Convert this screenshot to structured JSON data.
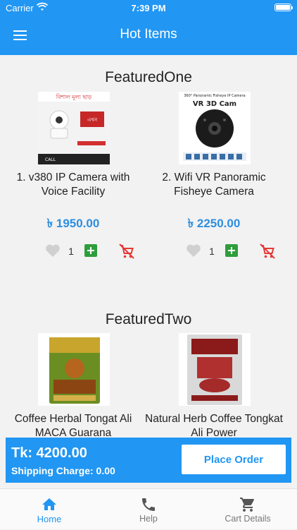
{
  "status_bar": {
    "carrier": "Carrier",
    "time": "7:39 PM"
  },
  "app_bar": {
    "title": "Hot Items",
    "menu_icon": "hamburger-menu-icon"
  },
  "sections": [
    {
      "title": "FeaturedOne",
      "products": [
        {
          "name": "1. v380 IP Camera with Voice Facility",
          "price": "৳ 1950.00",
          "quantity": "1",
          "image_text": [
            "বিশাল মূল্য ছাড়",
            "এখন",
            "CALL"
          ]
        },
        {
          "name": "2. Wifi VR Panoramic Fisheye Camera",
          "price": "৳ 2250.00",
          "quantity": "1",
          "image_text": [
            "360° Panoramic Fisheye IP Camera",
            "VR 3D Cam"
          ]
        }
      ]
    },
    {
      "title": "FeaturedTwo",
      "products": [
        {
          "name": "Coffee Herbal Tongat Ali MACA Guarana",
          "price": "",
          "quantity": ""
        },
        {
          "name": "Natural Herb Coffee Tongkat Ali Power",
          "price": "",
          "quantity": ""
        }
      ]
    }
  ],
  "summary": {
    "total": "Tk: 4200.00",
    "shipping": "Shipping Charge: 0.00",
    "place_order_label": "Place Order"
  },
  "tabbar": {
    "items": [
      {
        "label": "Home",
        "icon": "home-icon",
        "active": true
      },
      {
        "label": "Help",
        "icon": "phone-icon",
        "active": false
      },
      {
        "label": "Cart Details",
        "icon": "cart-icon",
        "active": false
      }
    ]
  },
  "colors": {
    "primary": "#2196f3",
    "price": "#2d8fe0",
    "add": "#2e9e3c",
    "remove": "#e53935"
  }
}
